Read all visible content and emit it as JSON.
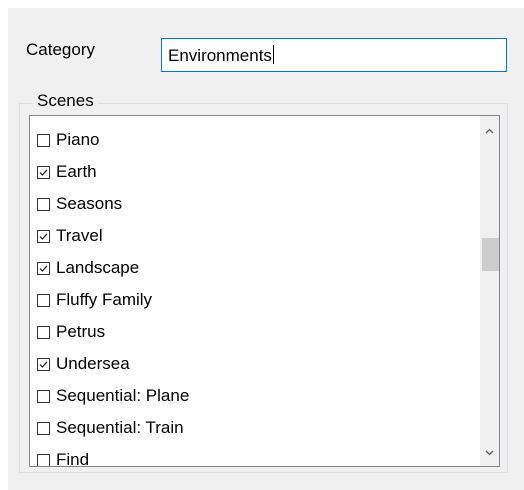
{
  "category": {
    "label": "Category",
    "value": "Environments"
  },
  "scenes": {
    "title": "Scenes",
    "items": [
      {
        "label": "Piano",
        "checked": false
      },
      {
        "label": "Earth",
        "checked": true
      },
      {
        "label": "Seasons",
        "checked": false
      },
      {
        "label": "Travel",
        "checked": true
      },
      {
        "label": "Landscape",
        "checked": true
      },
      {
        "label": "Fluffy Family",
        "checked": false
      },
      {
        "label": "Petrus",
        "checked": false
      },
      {
        "label": "Undersea",
        "checked": true
      },
      {
        "label": "Sequential: Plane",
        "checked": false
      },
      {
        "label": "Sequential: Train",
        "checked": false
      },
      {
        "label": "Find",
        "checked": false
      }
    ]
  },
  "icons": {
    "scroll_up": "chevron-up-icon",
    "scroll_down": "chevron-down-icon",
    "check": "checkmark-icon"
  },
  "colors": {
    "input_focus_border": "#0078d7",
    "panel_background": "#f0f0f0",
    "scroll_thumb": "#cdcdcd"
  }
}
